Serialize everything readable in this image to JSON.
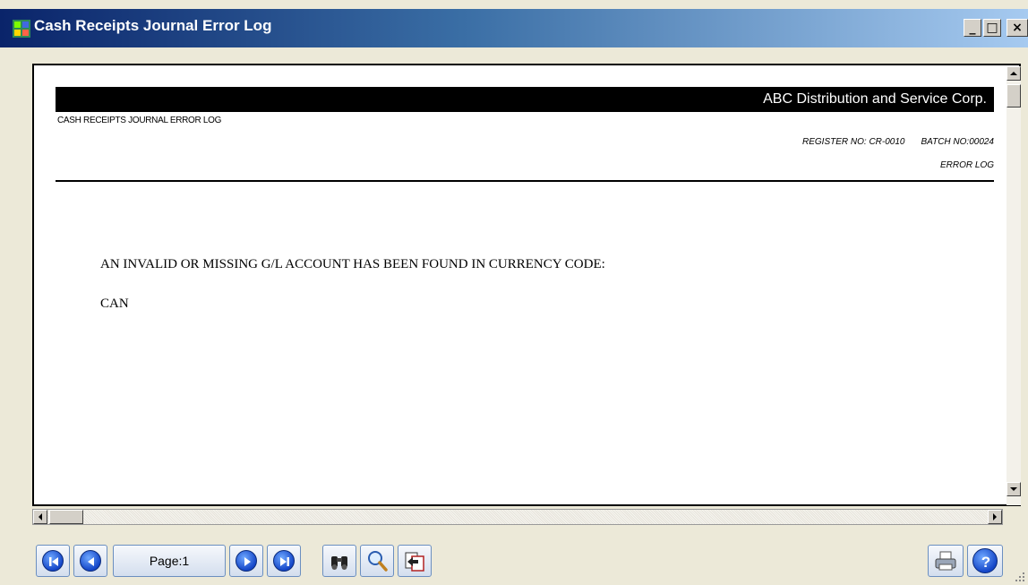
{
  "window": {
    "title": "Cash Receipts Journal Error Log",
    "minimize_label": "_",
    "maximize_label": "□",
    "close_label": "×"
  },
  "report": {
    "company": "ABC Distribution and Service Corp.",
    "name": "CASH RECEIPTS JOURNAL ERROR LOG",
    "register_no": "REGISTER NO: CR-0010",
    "batch_no": "BATCH NO:00024",
    "log_type": "ERROR LOG",
    "message": "AN INVALID OR MISSING G/L ACCOUNT HAS BEEN FOUND IN CURRENCY CODE:",
    "currency_code": "CAN"
  },
  "toolbar": {
    "page_label": "Page:1"
  },
  "icons": {
    "first": "first-page-icon",
    "prev": "previous-page-icon",
    "next": "next-page-icon",
    "last": "last-page-icon",
    "find": "binoculars-icon",
    "zoom": "magnifier-icon",
    "export": "export-icon",
    "print": "printer-icon",
    "help": "help-icon"
  },
  "colors": {
    "title_start": "#0A246A",
    "title_end": "#A6CAF0",
    "button_blue": "#1446C8"
  }
}
